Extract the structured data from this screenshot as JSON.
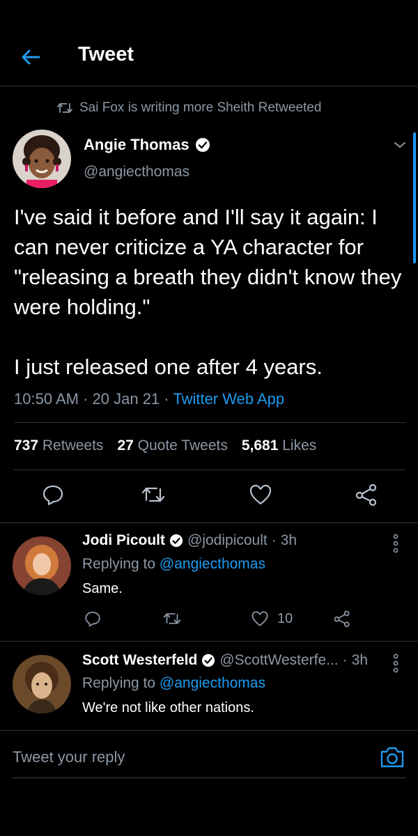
{
  "header": {
    "title": "Tweet",
    "back_icon": "arrow-left-icon"
  },
  "context": {
    "retweeted_by": "Sai Fox is writing more Sheith Retweeted"
  },
  "tweet": {
    "author_name": "Angie Thomas",
    "author_handle": "@angiecthomas",
    "text": "I've said it before and I'll say it again: I can never criticize a YA character for \"releasing a breath they didn't know they were holding.\"\n\nI just released one after 4 years.",
    "time": "10:50 AM",
    "date": "20 Jan 21",
    "source": "Twitter Web App",
    "retweets_count": "737",
    "retweets_label": "Retweets",
    "quotes_count": "27",
    "quotes_label": "Quote Tweets",
    "likes_count": "5,681",
    "likes_label": "Likes"
  },
  "replies": [
    {
      "name": "Jodi Picoult",
      "handle": "@jodipicoult",
      "age": "3h",
      "replying_prefix": "Replying to",
      "replying_to": "@angiecthomas",
      "text": "Same.",
      "like_count": "10"
    },
    {
      "name": "Scott Westerfeld",
      "handle": "@ScottWesterfe...",
      "age": "3h",
      "replying_prefix": "Replying to",
      "replying_to": "@angiecthomas",
      "text": "We're not like other nations."
    }
  ],
  "compose": {
    "placeholder": "Tweet your reply"
  },
  "colors": {
    "accent": "#1d9bf0",
    "background": "#000000",
    "muted": "#8b98a5",
    "divider": "#2f3336"
  }
}
